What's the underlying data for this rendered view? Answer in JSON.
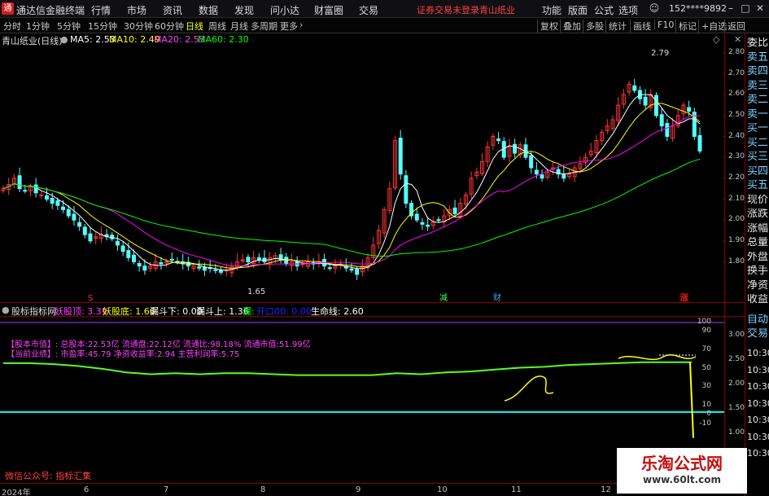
{
  "titlebar": {
    "logo": "通",
    "app_title": "通达信金融终端",
    "menu": [
      "行情",
      "市场",
      "资讯",
      "数据",
      "发现",
      "问小达",
      "财富圈",
      "交易"
    ],
    "login_status": "证券交易未登录",
    "stock_name": "青山纸业",
    "right_menu": [
      "功能",
      "版面",
      "公式",
      "选项"
    ],
    "user": "152****9892"
  },
  "toolbar": {
    "periods": [
      "分时",
      "1分钟",
      "5分钟",
      "15分钟",
      "30分钟",
      "60分钟",
      "日线",
      "周线",
      "月线",
      "多周期",
      "更多"
    ],
    "active": "日线",
    "right_buttons": [
      "复权",
      "叠加",
      "多股",
      "统计",
      "画线",
      "F10",
      "标记",
      "+自选",
      "返回"
    ]
  },
  "chart_info": {
    "title": "青山纸业(日线)",
    "ma5": "MA5: 2.53",
    "ma10": "MA10: 2.49",
    "ma20": "MA20: 2.53",
    "ma60": "MA60: 2.30"
  },
  "right_panel": {
    "labels": [
      "委比",
      "卖五",
      "卖四",
      "卖三",
      "卖二",
      "卖一",
      "买一",
      "买二",
      "买三",
      "买四",
      "买五",
      "现价",
      "涨跌",
      "涨幅",
      "总量",
      "外盘",
      "换手",
      "净资",
      "收益"
    ],
    "tabs": [
      "自动",
      "交易"
    ],
    "times": [
      "10:30",
      "10:30",
      "10:30",
      "10:30",
      "10:30",
      "10:30",
      "10:30"
    ]
  },
  "indicator": {
    "name": "股标指标网",
    "yao_top": "妖股顶: 3.39",
    "yao_bottom": "妖股底: 1.66",
    "loudou_down": "漏斗下: 0.00",
    "loudou_up": "漏斗上: 1.36",
    "lou": "漏:",
    "kaikou": "开口00: 0.00",
    "life": "生命线: 2.60"
  },
  "fundamentals": {
    "line1": "【股本市值】: 总股本:22.53亿 流通盘:22.12亿 流通比:98.18% 流通市值:51.99亿",
    "line2": "【当前业绩】: 市盈率:45.79 净资收益率:2.94 主营利润率:5.75"
  },
  "footer": {
    "wechat": "微信公众号: 指标汇集",
    "dates": [
      "2024年",
      "6",
      "7",
      "8",
      "9",
      "10",
      "11",
      "12"
    ]
  },
  "watermark": {
    "title": "乐淘公式网",
    "url": "www.60lt.com"
  },
  "markers": {
    "low_price": "1.65",
    "high_price": "2.79",
    "s_mark": "S",
    "jian_mark": "减",
    "cai_mark": "财",
    "zhang_mark": "涨"
  },
  "colors": {
    "up": "#ff3333",
    "down": "#54ffff",
    "ma5": "#ffffff",
    "ma10": "#ffff00",
    "ma20": "#ff00ff",
    "ma60": "#00ff00",
    "life": "#55ff22",
    "cyan": "#00ffff"
  },
  "chart_data": [
    {
      "type": "candlestick",
      "title": "青山纸业(日线)",
      "ylim": [
        1.65,
        2.85
      ],
      "y_ticks": [
        "2.80",
        "2.70",
        "2.60",
        "2.50",
        "2.40",
        "2.30",
        "2.20",
        "2.10",
        "2.00",
        "1.90",
        "1.80"
      ],
      "x_labels": [
        "2024年",
        "6",
        "7",
        "8",
        "9",
        "10",
        "11",
        "12"
      ],
      "series": [
        {
          "name": "MA5",
          "last": 2.53
        },
        {
          "name": "MA10",
          "last": 2.49
        },
        {
          "name": "MA20",
          "last": 2.53
        },
        {
          "name": "MA60",
          "last": 2.3
        }
      ],
      "close": [
        2.15,
        2.17,
        2.2,
        2.15,
        2.14,
        2.16,
        2.13,
        2.12,
        2.1,
        2.08,
        2.07,
        2.05,
        2.02,
        2.0,
        1.97,
        1.93,
        1.9,
        1.92,
        1.93,
        1.92,
        1.91,
        1.88,
        1.85,
        1.82,
        1.8,
        1.78,
        1.76,
        1.78,
        1.8,
        1.79,
        1.8,
        1.81,
        1.8,
        1.79,
        1.78,
        1.78,
        1.77,
        1.76,
        1.77,
        1.76,
        1.75,
        1.76,
        1.78,
        1.8,
        1.81,
        1.8,
        1.82,
        1.81,
        1.8,
        1.82,
        1.83,
        1.81,
        1.79,
        1.8,
        1.78,
        1.79,
        1.8,
        1.79,
        1.8,
        1.78,
        1.77,
        1.78,
        1.79,
        1.77,
        1.76,
        1.74,
        1.78,
        1.82,
        1.88,
        1.95,
        2.05,
        2.15,
        2.38,
        2.22,
        2.08,
        2.02,
        2.0,
        1.98,
        1.97,
        1.99,
        2.0,
        2.02,
        2.05,
        2.03,
        2.08,
        2.12,
        2.2,
        2.23,
        2.28,
        2.35,
        2.4,
        2.38,
        2.3,
        2.35,
        2.32,
        2.36,
        2.3,
        2.25,
        2.22,
        2.2,
        2.23,
        2.25,
        2.22,
        2.2,
        2.22,
        2.25,
        2.27,
        2.3,
        2.33,
        2.38,
        2.42,
        2.45,
        2.48,
        2.55,
        2.6,
        2.65,
        2.62,
        2.58,
        2.55,
        2.6,
        2.5,
        2.45,
        2.4,
        2.45,
        2.5,
        2.55,
        2.52,
        2.4,
        2.33
      ]
    },
    {
      "type": "line",
      "title": "",
      "ylim": [
        -20,
        100
      ],
      "y_ticks_left": [
        "100",
        "90",
        "70",
        "50",
        "30",
        "10",
        "0",
        "-10"
      ],
      "y_ticks_right": [
        "3.00",
        "2.50",
        "2.00",
        "1.50",
        "1.00"
      ],
      "series": [
        {
          "name": "生命线",
          "values": [
            56,
            56,
            55,
            53,
            50,
            46,
            44,
            45,
            44,
            45,
            45,
            44,
            43,
            43,
            43,
            43,
            45,
            44,
            46,
            47,
            49,
            51,
            52,
            54,
            55,
            56,
            57,
            57,
            57,
            -25
          ]
        }
      ]
    }
  ]
}
